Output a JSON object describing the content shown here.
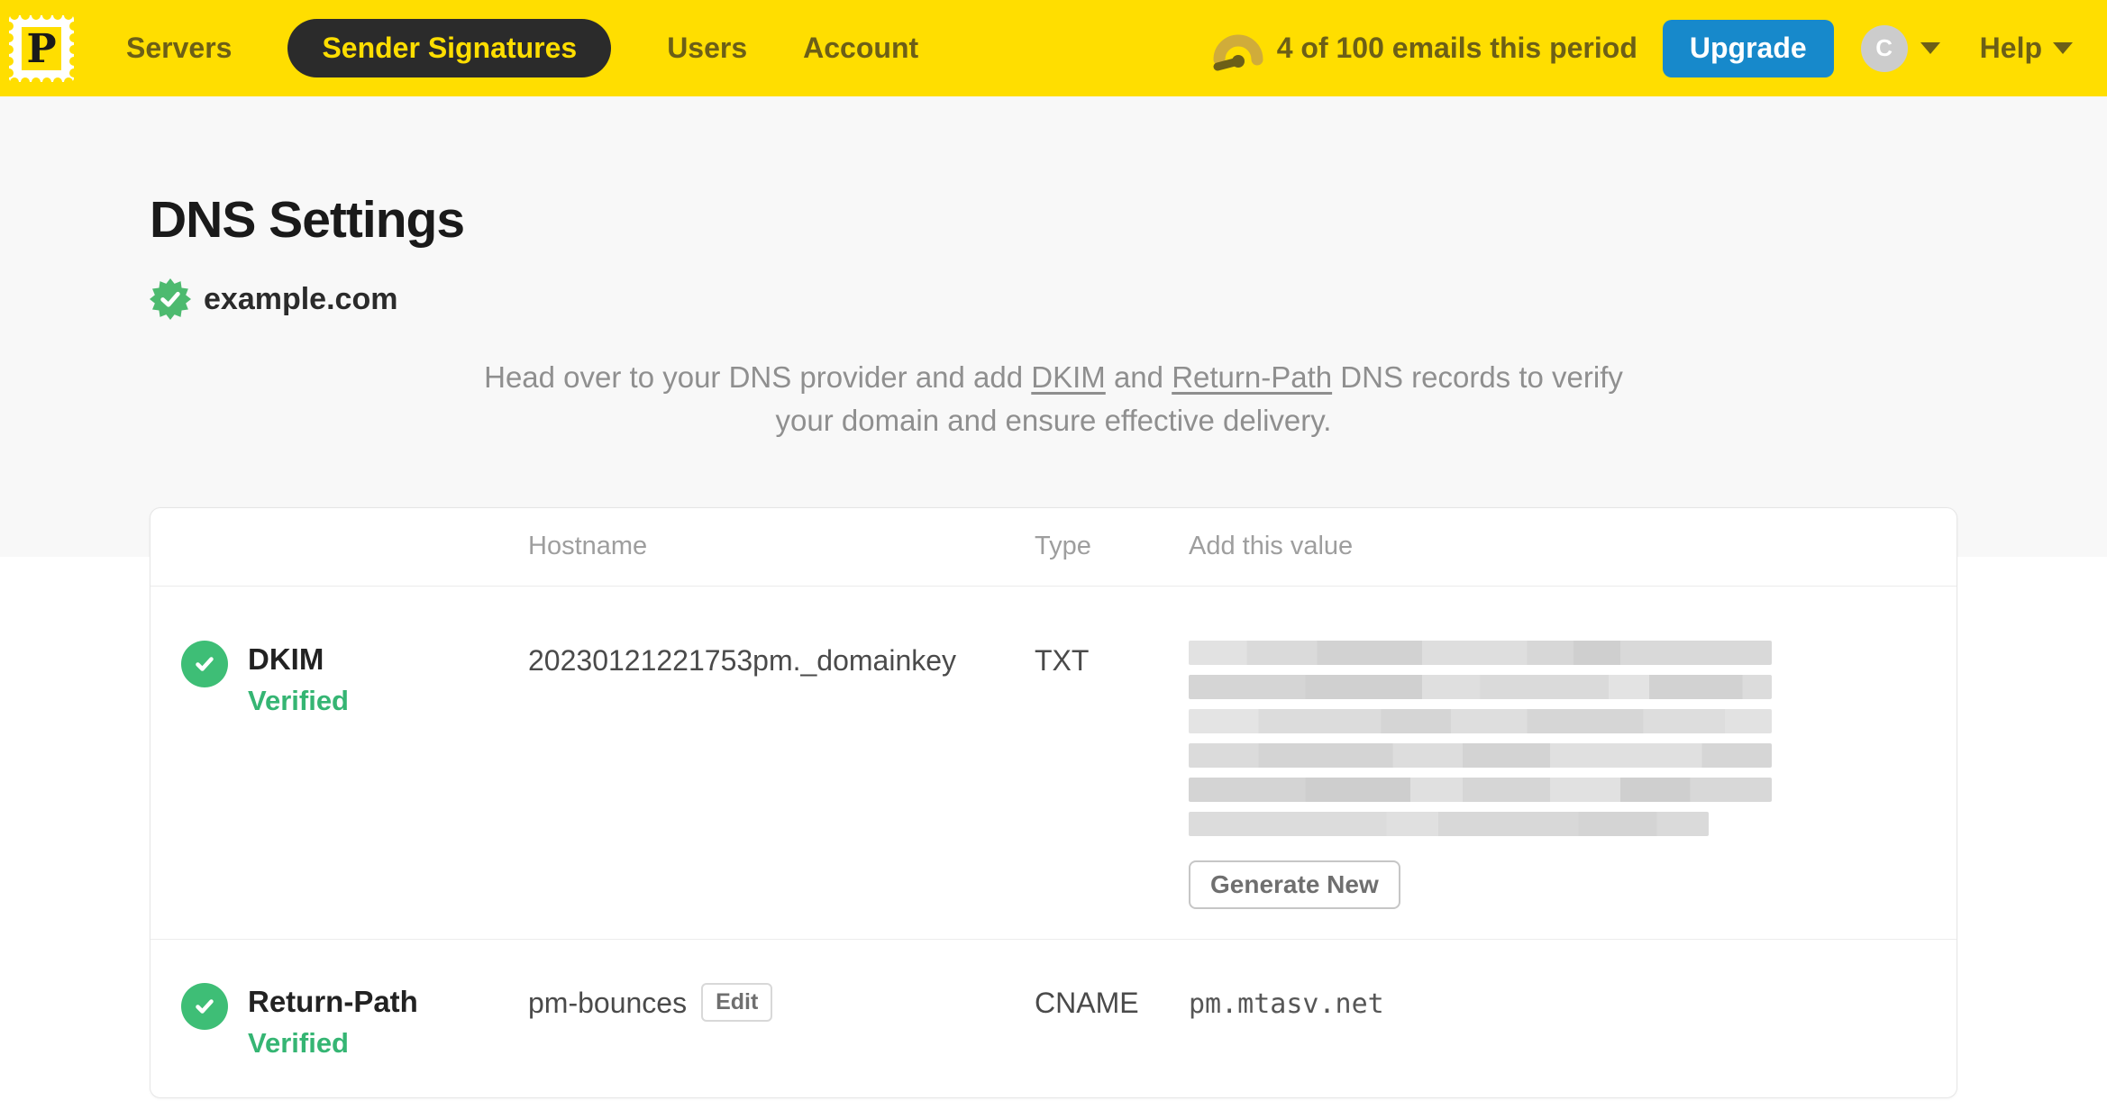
{
  "nav": {
    "brand_letter": "P",
    "items": [
      {
        "label": "Servers",
        "active": false
      },
      {
        "label": "Sender Signatures",
        "active": true
      },
      {
        "label": "Users",
        "active": false
      },
      {
        "label": "Account",
        "active": false
      }
    ],
    "usage_text": "4 of 100 emails this period",
    "upgrade_label": "Upgrade",
    "avatar_initial": "C",
    "help_label": "Help"
  },
  "page": {
    "title": "DNS Settings",
    "domain": "example.com",
    "domain_verified": true,
    "intro": {
      "part1": "Head over to your DNS provider and add ",
      "link1": "DKIM",
      "part2": " and ",
      "link2": "Return-Path",
      "part3": " DNS records to verify your domain and ensure effective delivery."
    }
  },
  "table": {
    "headers": {
      "hostname": "Hostname",
      "type": "Type",
      "value": "Add this value"
    },
    "rows": [
      {
        "name": "DKIM",
        "status": "Verified",
        "hostname": "20230121221753pm._domainkey",
        "type": "TXT",
        "value_masked": true,
        "action_label": "Generate New"
      },
      {
        "name": "Return-Path",
        "status": "Verified",
        "hostname": "pm-bounces",
        "hostname_action_label": "Edit",
        "type": "CNAME",
        "value": "pm.mtasv.net"
      }
    ]
  },
  "icons": {
    "logo": "postmark-stamp-icon",
    "usage": "gauge-icon",
    "verified_badge": "seal-check-icon",
    "row_status": "check-circle-icon",
    "dropdown": "chevron-down-icon"
  },
  "colors": {
    "brand_yellow": "#FFDE00",
    "nav_text": "#6C5F17",
    "active_pill_bg": "#2B2B2B",
    "upgrade_blue": "#1789CB",
    "verified_green": "#35B573",
    "check_circle_green": "#3EBE76",
    "page_bg_top": "#F8F8F8",
    "card_border": "#E6E6E6"
  }
}
